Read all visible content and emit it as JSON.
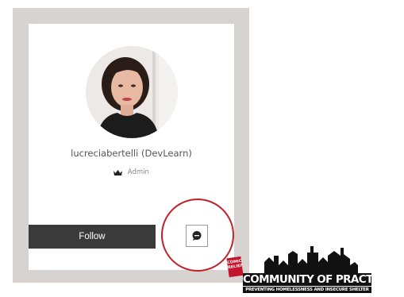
{
  "profile": {
    "username": "lucreciabertelli (DevLearn)",
    "role_label": "Admin",
    "role_icon": "crown-icon"
  },
  "actions": {
    "follow_label": "Follow",
    "message_icon": "chat-bubble-icon"
  },
  "annotation": {
    "highlight_color": "#c01f25"
  },
  "logo": {
    "tag_text": "COMIC RELIEF",
    "title": "COMMUNITY OF PRACTICE",
    "subtitle": "PREVENTING HOMELESSNESS AND INSECURE SHELTER",
    "tag_color": "#c4142d"
  }
}
